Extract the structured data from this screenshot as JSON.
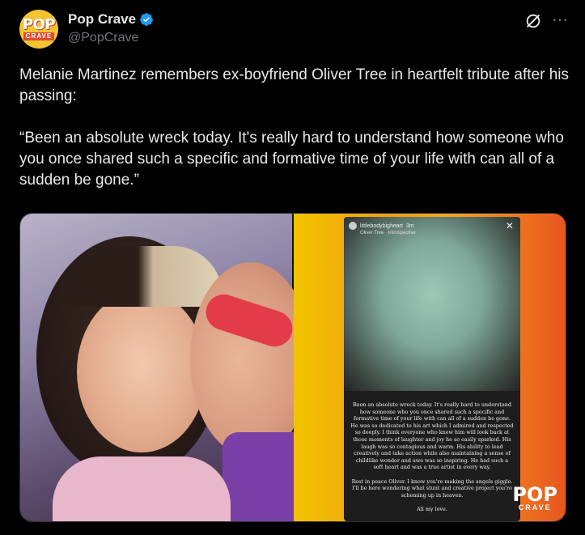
{
  "author": {
    "name": "Pop Crave",
    "handle": "@PopCrave",
    "avatar_logo_top": "POP",
    "avatar_logo_bottom": "CRAVE"
  },
  "icons": [
    "verified-badge-icon",
    "grok-icon",
    "more-icon"
  ],
  "colors": {
    "verified": "#1d9bf0",
    "background": "#000000",
    "text": "#e7e9ea",
    "muted": "#71767b"
  },
  "tweet": {
    "text": "Melanie Martinez remembers ex-boyfriend Oliver Tree in heartfelt tribute after his passing:\n\n“Been an absolute wreck today. It's really hard to understand how someone who you once shared such a specific and formative time of your life with can all of a sudden be gone.”"
  },
  "story": {
    "username": "littlebodybigheart",
    "time": "3m",
    "song": "Oliver Tree · Introspective",
    "text": "Been an absolute wreck today. It's really hard to understand how someone who you once shared such a specific and formative time of your life with can all of a sudden be gone. He was so dedicated to his art which I admired and respected so deeply. I think everyone who knew him will look back at those moments of laughter and joy he so easily sparked. His laugh was so contagious and warm. His ability to lead creatively and take action while also maintaining a sense of childlike wonder and awe was so inspiring. He had such a soft heart and was a true artist in every way.\n\nRest in peace Oliver. I know you're making the angels giggle. I'll be here wondering what stunt and creative project you're scheming up in heaven.\n\nAll my love."
  },
  "watermark": {
    "top": "POP",
    "bottom": "CRAVE"
  }
}
